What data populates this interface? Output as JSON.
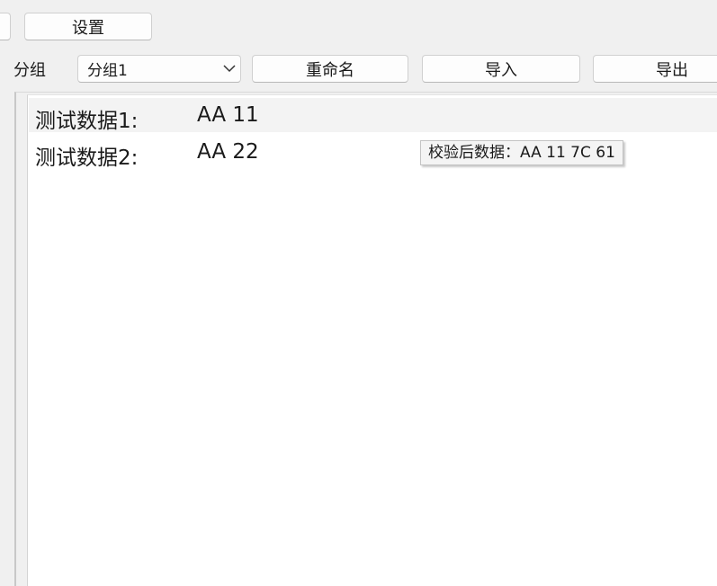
{
  "toolbar": {
    "settings_label": "设置"
  },
  "group_bar": {
    "group_label": "分组",
    "selected_group": "分组1",
    "rename_label": "重命名",
    "import_label": "导入",
    "export_label": "导出"
  },
  "data_rows": [
    {
      "label": "测试数据1:",
      "value": "AA 11"
    },
    {
      "label": "测试数据2:",
      "value": "AA 22"
    }
  ],
  "tooltip": {
    "text": "校验后数据：AA 11 7C 61"
  },
  "icons": {
    "combo_arrow": "chevron-down-icon"
  },
  "colors": {
    "background": "#f0f0f0",
    "panel": "#ffffff",
    "row_alt": "#f3f3f3",
    "button": "#fdfdfd"
  }
}
